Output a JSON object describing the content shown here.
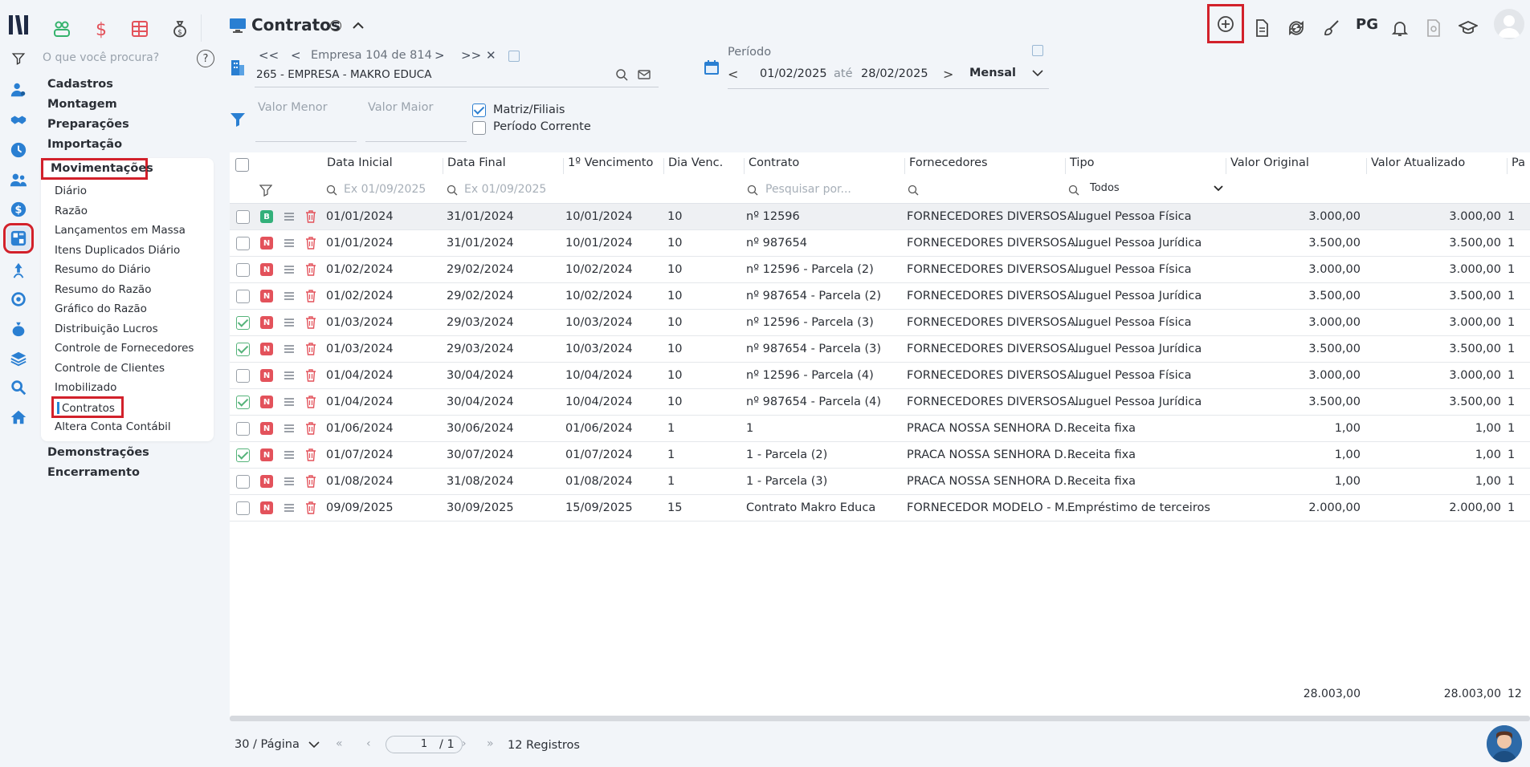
{
  "app": {
    "title": "Contratos",
    "search_placeholder": "O que você procura?"
  },
  "colors": {
    "accent": "#2486d8",
    "highlight": "#d2212b",
    "badge_b": "#33b07a",
    "badge_n": "#e3525b"
  },
  "sidebar": {
    "sections": [
      "Cadastros",
      "Montagem",
      "Preparações",
      "Importação"
    ],
    "active_section": "Movimentações",
    "items": [
      "Diário",
      "Razão",
      "Lançamentos em Massa",
      "Itens Duplicados Diário",
      "Resumo do Diário",
      "Resumo do Razão",
      "Gráfico do Razão",
      "Distribuição Lucros",
      "Controle de Fornecedores",
      "Controle de Clientes",
      "Imobilizado"
    ],
    "active_item": "Contratos",
    "after_items": [
      "Altera Conta Contábil"
    ],
    "sections_after": [
      "Demonstrações",
      "Encerramento"
    ]
  },
  "header": {
    "pg_label": "PG"
  },
  "empresa": {
    "nav_first": "<<",
    "nav_prev": "<",
    "nav_next": ">",
    "nav_last": ">>",
    "nav_clear": "✕",
    "position": "Empresa 104 de 814",
    "name": "265 - EMPRESA - MAKRO EDUCA"
  },
  "periodo": {
    "label": "Período",
    "start": "01/02/2025",
    "ate": "até",
    "end": "28/02/2025",
    "mode": "Mensal",
    "prev": "<",
    "next": ">"
  },
  "filters": {
    "valor_menor": "Valor Menor",
    "valor_maior": "Valor Maior",
    "matriz_filiais": "Matriz/Filiais",
    "periodo_corrente": "Período Corrente"
  },
  "table": {
    "columns": [
      "Data Inicial",
      "Data Final",
      "1º Vencimento",
      "Dia Venc.",
      "Contrato",
      "Fornecedores",
      "Tipo",
      "Valor Original",
      "Valor Atualizado",
      "Pa"
    ],
    "filter_placeholders": {
      "data_inicial": "Ex 01/09/2025",
      "data_final": "Ex 01/09/2025",
      "contrato": "Pesquisar por...",
      "tipo": "Todos"
    },
    "rows": [
      {
        "checked": false,
        "badge": "B",
        "data_inicial": "01/01/2024",
        "data_final": "31/01/2024",
        "vencimento": "10/01/2024",
        "dia": "10",
        "contrato": "nº 12596",
        "fornecedor": "FORNECEDORES DIVERSOS ...",
        "tipo": "Aluguel Pessoa Física",
        "valor_original": "3.000,00",
        "valor_atualizado": "3.000,00",
        "pa": "1"
      },
      {
        "checked": false,
        "badge": "N",
        "data_inicial": "01/01/2024",
        "data_final": "31/01/2024",
        "vencimento": "10/01/2024",
        "dia": "10",
        "contrato": "nº 987654",
        "fornecedor": "FORNECEDORES DIVERSOS ...",
        "tipo": "Aluguel Pessoa Jurídica",
        "valor_original": "3.500,00",
        "valor_atualizado": "3.500,00",
        "pa": "1"
      },
      {
        "checked": false,
        "badge": "N",
        "data_inicial": "01/02/2024",
        "data_final": "29/02/2024",
        "vencimento": "10/02/2024",
        "dia": "10",
        "contrato": "nº 12596 - Parcela (2)",
        "fornecedor": "FORNECEDORES DIVERSOS ...",
        "tipo": "Aluguel Pessoa Física",
        "valor_original": "3.000,00",
        "valor_atualizado": "3.000,00",
        "pa": "1"
      },
      {
        "checked": false,
        "badge": "N",
        "data_inicial": "01/02/2024",
        "data_final": "29/02/2024",
        "vencimento": "10/02/2024",
        "dia": "10",
        "contrato": "nº 987654 - Parcela (2)",
        "fornecedor": "FORNECEDORES DIVERSOS ...",
        "tipo": "Aluguel Pessoa Jurídica",
        "valor_original": "3.500,00",
        "valor_atualizado": "3.500,00",
        "pa": "1"
      },
      {
        "checked": true,
        "badge": "N",
        "data_inicial": "01/03/2024",
        "data_final": "29/03/2024",
        "vencimento": "10/03/2024",
        "dia": "10",
        "contrato": "nº 12596 - Parcela (3)",
        "fornecedor": "FORNECEDORES DIVERSOS ...",
        "tipo": "Aluguel Pessoa Física",
        "valor_original": "3.000,00",
        "valor_atualizado": "3.000,00",
        "pa": "1"
      },
      {
        "checked": true,
        "badge": "N",
        "data_inicial": "01/03/2024",
        "data_final": "29/03/2024",
        "vencimento": "10/03/2024",
        "dia": "10",
        "contrato": "nº 987654 - Parcela (3)",
        "fornecedor": "FORNECEDORES DIVERSOS ...",
        "tipo": "Aluguel Pessoa Jurídica",
        "valor_original": "3.500,00",
        "valor_atualizado": "3.500,00",
        "pa": "1"
      },
      {
        "checked": false,
        "badge": "N",
        "data_inicial": "01/04/2024",
        "data_final": "30/04/2024",
        "vencimento": "10/04/2024",
        "dia": "10",
        "contrato": "nº 12596 - Parcela (4)",
        "fornecedor": "FORNECEDORES DIVERSOS ...",
        "tipo": "Aluguel Pessoa Física",
        "valor_original": "3.000,00",
        "valor_atualizado": "3.000,00",
        "pa": "1"
      },
      {
        "checked": true,
        "badge": "N",
        "data_inicial": "01/04/2024",
        "data_final": "30/04/2024",
        "vencimento": "10/04/2024",
        "dia": "10",
        "contrato": "nº 987654 - Parcela (4)",
        "fornecedor": "FORNECEDORES DIVERSOS ...",
        "tipo": "Aluguel Pessoa Jurídica",
        "valor_original": "3.500,00",
        "valor_atualizado": "3.500,00",
        "pa": "1"
      },
      {
        "checked": false,
        "badge": "N",
        "data_inicial": "01/06/2024",
        "data_final": "30/06/2024",
        "vencimento": "01/06/2024",
        "dia": "1",
        "contrato": "1",
        "fornecedor": "PRACA NOSSA SENHORA D...",
        "tipo": "Receita fixa",
        "valor_original": "1,00",
        "valor_atualizado": "1,00",
        "pa": "1"
      },
      {
        "checked": true,
        "badge": "N",
        "data_inicial": "01/07/2024",
        "data_final": "30/07/2024",
        "vencimento": "01/07/2024",
        "dia": "1",
        "contrato": "1 - Parcela (2)",
        "fornecedor": "PRACA NOSSA SENHORA D...",
        "tipo": "Receita fixa",
        "valor_original": "1,00",
        "valor_atualizado": "1,00",
        "pa": "1"
      },
      {
        "checked": false,
        "badge": "N",
        "data_inicial": "01/08/2024",
        "data_final": "31/08/2024",
        "vencimento": "01/08/2024",
        "dia": "1",
        "contrato": "1 - Parcela (3)",
        "fornecedor": "PRACA NOSSA SENHORA D...",
        "tipo": "Receita fixa",
        "valor_original": "1,00",
        "valor_atualizado": "1,00",
        "pa": "1"
      },
      {
        "checked": false,
        "badge": "N",
        "data_inicial": "09/09/2025",
        "data_final": "30/09/2025",
        "vencimento": "15/09/2025",
        "dia": "15",
        "contrato": "Contrato Makro Educa",
        "fornecedor": "FORNECEDOR MODELO - M...",
        "tipo": "Empréstimo de terceiros",
        "valor_original": "2.000,00",
        "valor_atualizado": "2.000,00",
        "pa": "1"
      }
    ],
    "totals": {
      "valor_original": "28.003,00",
      "valor_atualizado": "28.003,00",
      "pa": "12"
    }
  },
  "pagination": {
    "page_size": "30 / Página",
    "page": "1",
    "total_pages": "/ 1",
    "count": "12 Registros",
    "first": "«",
    "prev": "‹",
    "next": "›",
    "last": "»"
  }
}
